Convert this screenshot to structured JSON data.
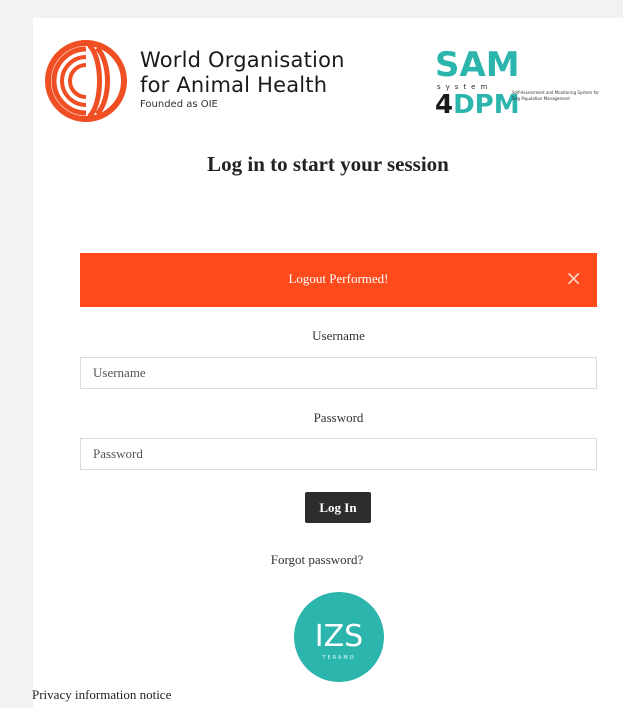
{
  "header": {
    "org_line1": "World Organisation",
    "org_line2": "for Animal Health",
    "org_line3": "Founded as OIE",
    "sam_top": "SAM",
    "sam_system": "system",
    "sam_four": "4",
    "sam_dpm": "DPM",
    "sam_caption": "Self-Assessment and Monitoring System for Dog Population Management"
  },
  "heading": "Log in to start your session",
  "alert": {
    "message": "Logout Performed!",
    "close": "×"
  },
  "form": {
    "username_label": "Username",
    "username_placeholder": "Username",
    "username_value": "",
    "password_label": "Password",
    "password_placeholder": "Password",
    "password_value": "",
    "login_label": "Log In",
    "forgot_label": "Forgot password?"
  },
  "izs_logo": {
    "text": "IZS",
    "subtext": "TERAMO"
  },
  "footer": {
    "privacy_label": "Privacy information notice"
  },
  "colors": {
    "alert_bg": "#ff4a1c",
    "brand_teal": "#2bb5ad",
    "brand_orange": "#f04e23",
    "button_dark": "#2b2d2f"
  },
  "icons": {
    "woah_logo": "woah-swirl-logo",
    "alert_close": "close-icon",
    "izs_logo": "izs-circle-logo"
  }
}
